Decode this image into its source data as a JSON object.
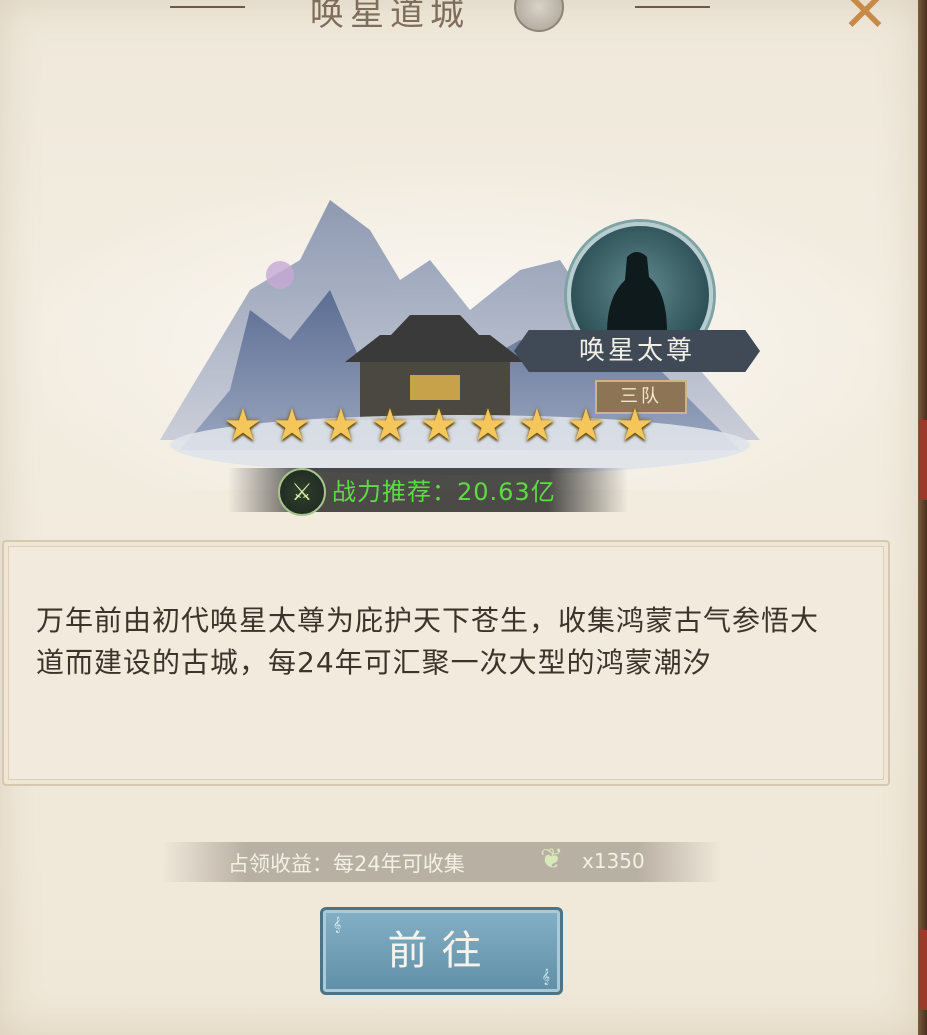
{
  "header": {
    "title": "唤星道城",
    "close_icon": "close-x-icon"
  },
  "boss": {
    "name": "唤星太尊",
    "team": "三队",
    "avatar_icon": "warrior-silhouette-icon"
  },
  "stars": {
    "count": 9,
    "max": 9,
    "glyph": "★"
  },
  "power": {
    "icon": "sword-icon",
    "text": "战力推荐：20.63亿"
  },
  "description": {
    "text": "万年前由初代唤星太尊为庇护天下苍生，收集鸿蒙古气参悟大道而建设的古城，每24年可汇聚一次大型的鸿蒙潮汐"
  },
  "reward": {
    "label": "占领收益：每24年可收集",
    "icon": "herb-leaf-icon",
    "amount": "x1350"
  },
  "actions": {
    "go_label": "前往"
  },
  "colors": {
    "panel_bg": "#efe8da",
    "power_green": "#5fda46",
    "star_gold": "#f5c75a",
    "button_blue": "#6f9fb8",
    "close_orange": "#c88a4a"
  }
}
